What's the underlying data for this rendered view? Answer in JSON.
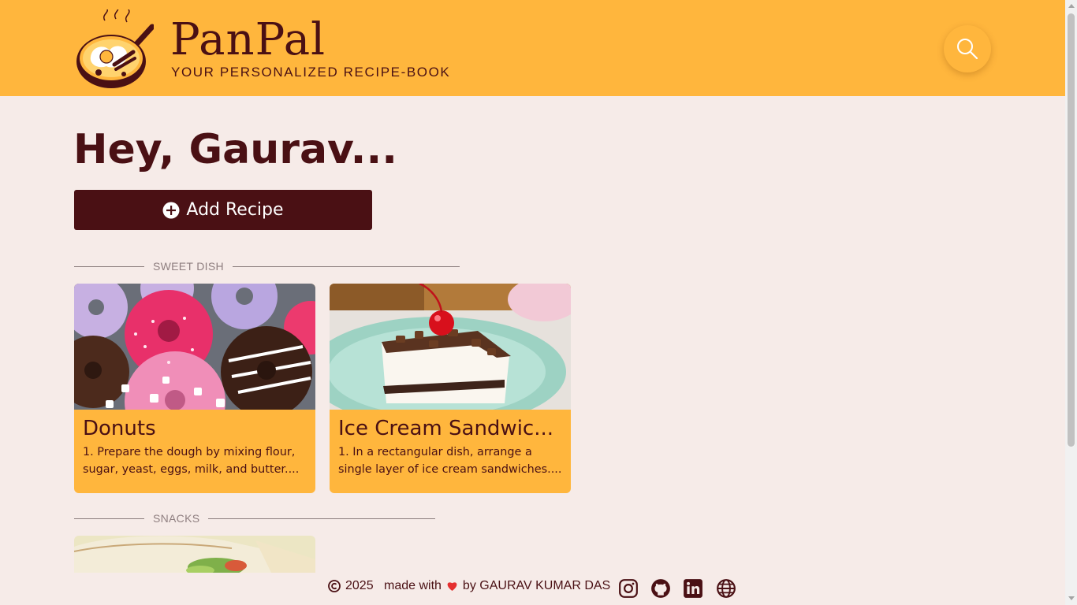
{
  "brand": {
    "name": "PanPal",
    "tagline": "YOUR PERSONALIZED RECIPE-BOOK"
  },
  "colors": {
    "accent": "#ffb63d",
    "primary": "#4a1014",
    "background": "#f6ebe8"
  },
  "header": {
    "search_icon": "search-icon"
  },
  "main": {
    "greeting": "Hey, Gaurav...",
    "add_recipe_label": "Add Recipe",
    "sections": [
      {
        "title": "SWEET DISH",
        "recipes": [
          {
            "title": "Donuts",
            "desc": "1. Prepare the dough by mixing flour, sugar, yeast, eggs, milk, and butter...."
          },
          {
            "title": "Ice Cream Sandwic...",
            "desc": "1. In a rectangular dish, arrange a single layer of ice cream sandwiches...."
          }
        ]
      },
      {
        "title": "SNACKS",
        "recipes": []
      }
    ]
  },
  "footer": {
    "copyright": "2025",
    "made_with": "made with",
    "by": "by GAURAV KUMAR DAS",
    "social_icons": [
      "instagram-icon",
      "github-icon",
      "linkedin-icon",
      "globe-icon"
    ]
  }
}
